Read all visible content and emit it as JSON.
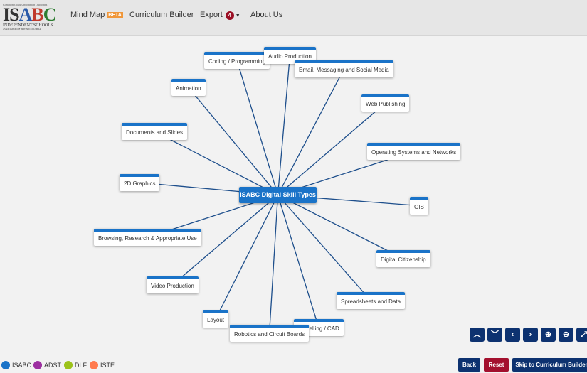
{
  "logo": {
    "tagline": "Common Goals Uncommon Outcomes",
    "name": "ISABC",
    "subtitle": "INDEPENDENT SCHOOLS",
    "org": "ASSOCIATION OF BRITISH COLUMBIA"
  },
  "nav": {
    "mind_map": "Mind Map",
    "beta": "BETA",
    "curriculum_builder": "Curriculum Builder",
    "export": "Export",
    "export_count": "4",
    "about": "About Us"
  },
  "mindmap": {
    "center": "ISABC Digital Skill Types",
    "nodes": [
      "Coding / Programming",
      "Audio Production",
      "Email, Messaging and Social Media",
      "Animation",
      "Web Publishing",
      "Documents and Slides",
      "Operating Systems and Networks",
      "2D Graphics",
      "GIS",
      "Browsing, Research & Appropriate Use",
      "Digital Citizenship",
      "Video Production",
      "Spreadsheets and Data",
      "Layout",
      "Modelling / CAD",
      "Robotics and Circuit Boards"
    ],
    "node_color": "#1a73c8",
    "line_color": "#1e4f8c"
  },
  "controls": {
    "up": "up",
    "down": "down",
    "left": "left",
    "right": "right",
    "zoom_in": "zoom-in",
    "zoom_out": "zoom-out",
    "fit": "fit"
  },
  "legend": [
    {
      "label": "ISABC",
      "color": "#1a73c8"
    },
    {
      "label": "ADST",
      "color": "#9c2fa0"
    },
    {
      "label": "DLF",
      "color": "#9cc21a"
    },
    {
      "label": "ISTE",
      "color": "#ff7a4d"
    }
  ],
  "buttons": {
    "back": "Back",
    "reset": "Reset",
    "skip": "Skip to Curriculum Builder"
  }
}
